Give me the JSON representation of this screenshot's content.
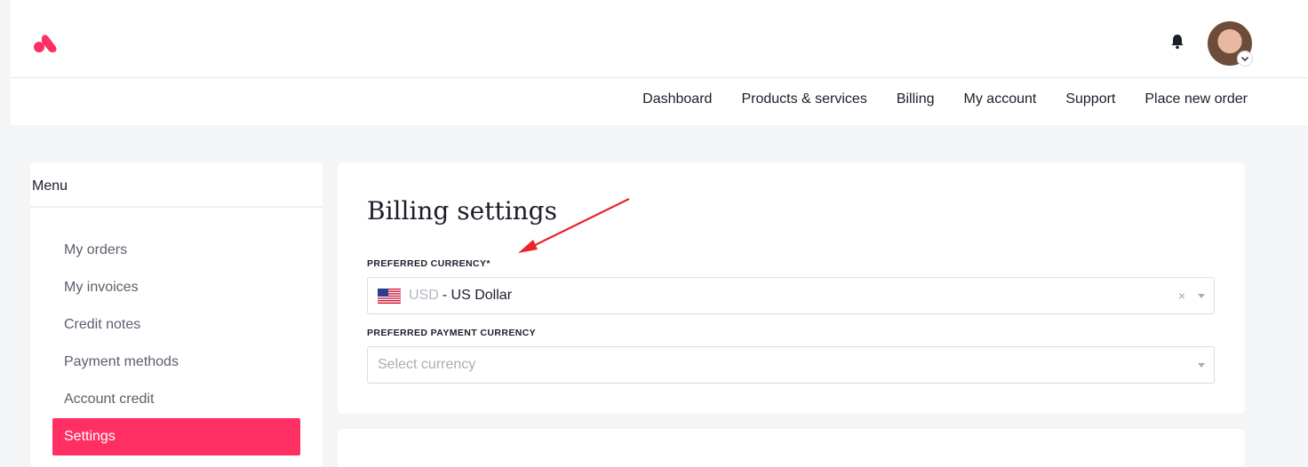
{
  "brand": {
    "accent": "#ff2e63"
  },
  "header": {
    "logo_icon": "logo-icon",
    "bell_icon": "bell-icon",
    "avatar_icon": "avatar",
    "nav": [
      {
        "label": "Dashboard"
      },
      {
        "label": "Products & services"
      },
      {
        "label": "Billing"
      },
      {
        "label": "My account"
      },
      {
        "label": "Support"
      },
      {
        "label": "Place new order"
      }
    ]
  },
  "sidebar": {
    "title": "Menu",
    "items": [
      {
        "label": "My orders"
      },
      {
        "label": "My invoices"
      },
      {
        "label": "Credit notes"
      },
      {
        "label": "Payment methods"
      },
      {
        "label": "Account credit"
      },
      {
        "label": "Settings",
        "active": true
      }
    ]
  },
  "main": {
    "title": "Billing settings",
    "preferred_currency": {
      "label": "PREFERRED CURRENCY*",
      "code": "USD",
      "name": "- US Dollar",
      "flag_icon": "us-flag-icon",
      "clear_icon": "×"
    },
    "payment_currency": {
      "label": "PREFERRED PAYMENT CURRENCY",
      "placeholder": "Select currency"
    }
  },
  "annotation": {
    "arrow_color": "#e8262a"
  }
}
